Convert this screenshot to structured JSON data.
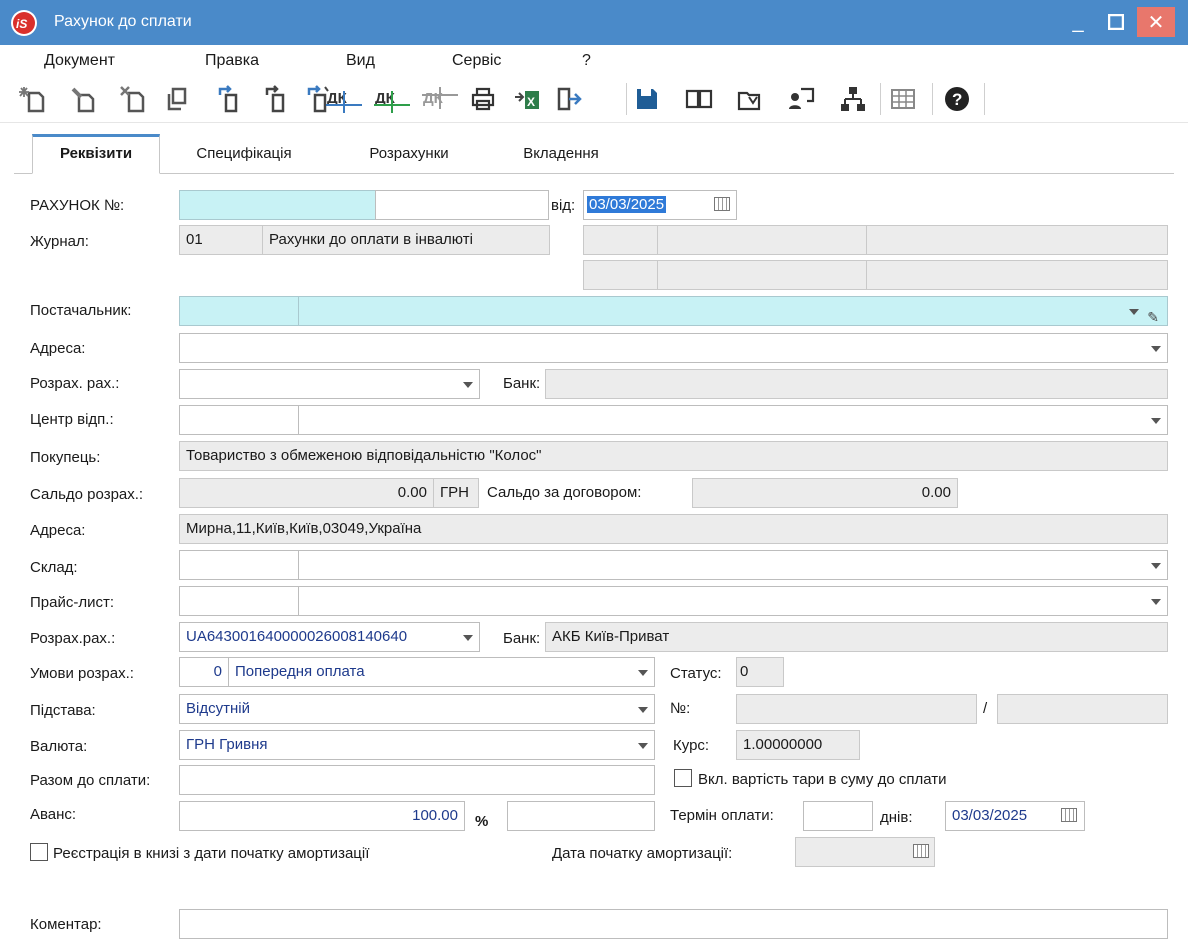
{
  "window": {
    "title": "Рахунок до сплати",
    "min": "_",
    "max": "☐",
    "close": "✕"
  },
  "menu": [
    "Документ",
    "Правка",
    "Вид",
    "Сервіс",
    "?"
  ],
  "toolbar_icons": [
    "add-doc-icon",
    "edit-doc-icon",
    "delete-doc-icon",
    "copy-doc-icon",
    "copy-with-icon",
    "copy-to-icon",
    "create-from-icon",
    "debit-credit-icon",
    "debit-credit-green-icon",
    "debit-credit-gray-icon",
    "print-icon",
    "excel-export-icon",
    "exit-icon",
    "save-icon",
    "journal-book-icon",
    "attach-icon",
    "user-card-icon",
    "tree-structure-icon",
    "grid-icon",
    "help-icon"
  ],
  "tabs": [
    "Реквізити",
    "Специфікація",
    "Розрахунки",
    "Вкладення"
  ],
  "form": {
    "invoice_no_label": "РАХУНОК №:",
    "invoice_no_value": "",
    "invoice_no_suffix": "",
    "from_label": "від:",
    "date": "03/03/2025",
    "journal_label": "Журнал:",
    "journal_code": "01",
    "journal_name": "Рахунки до оплати в інвалюті",
    "supplier_label": "Постачальник:",
    "address_label": "Адреса:",
    "settle_acc_label": "Розрах. рах.:",
    "bank_label": "Банк:",
    "center_label": "Центр відп.:",
    "buyer_label": "Покупець:",
    "buyer_value": "Товариство з обмеженою відповідальністю \"Колос\"",
    "balance_label": "Сальдо розрах.:",
    "balance_value": "0.00",
    "balance_currency": "ГРН",
    "contract_balance_label": "Сальдо за договором:",
    "contract_balance_value": "0.00",
    "address2_label": "Адреса:",
    "address2_value": "Мирна,11,Київ,Київ,03049,Україна",
    "warehouse_label": "Склад:",
    "pricelist_label": "Прайс-лист:",
    "settle_acc2_label": "Розрах.рах.:",
    "settle_acc2_value": "UA643001640000026008140640",
    "bank2_label": "Банк:",
    "bank2_value": "АКБ Київ-Приват",
    "terms_label": "Умови розрах.:",
    "terms_code": "0",
    "terms_value": "Попередня оплата",
    "status_label": "Статус:",
    "status_value": "0",
    "basis_label": "Підстава:",
    "basis_value": "Відсутній",
    "no_label": "№:",
    "slash": "/",
    "currency_label": "Валюта:",
    "currency_value": "ГРН Гривня",
    "rate_label": "Курс:",
    "rate_value": "1.00000000",
    "total_label": "Разом до сплати:",
    "tara_label": "Вкл. вартість тари в суму до сплати",
    "advance_label": "Аванс:",
    "advance_value": "100.00",
    "percent": "%",
    "term_label": "Термін оплати:",
    "days_label": "днів:",
    "term_date": "03/03/2025",
    "reg_label": "Реєстрація в книзі з дати початку амортизації",
    "amort_label": "Дата початку амортизації:",
    "comment_label": "Коментар:"
  }
}
